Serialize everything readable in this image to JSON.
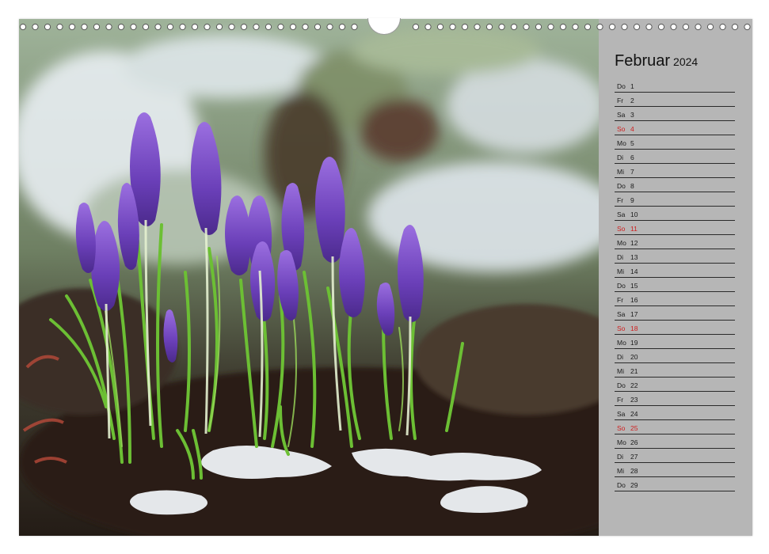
{
  "calendar": {
    "month": "Februar",
    "year": "2024",
    "days": [
      {
        "dow": "Do",
        "day": "1",
        "sunday": false
      },
      {
        "dow": "Fr",
        "day": "2",
        "sunday": false
      },
      {
        "dow": "Sa",
        "day": "3",
        "sunday": false
      },
      {
        "dow": "So",
        "day": "4",
        "sunday": true
      },
      {
        "dow": "Mo",
        "day": "5",
        "sunday": false
      },
      {
        "dow": "Di",
        "day": "6",
        "sunday": false
      },
      {
        "dow": "Mi",
        "day": "7",
        "sunday": false
      },
      {
        "dow": "Do",
        "day": "8",
        "sunday": false
      },
      {
        "dow": "Fr",
        "day": "9",
        "sunday": false
      },
      {
        "dow": "Sa",
        "day": "10",
        "sunday": false
      },
      {
        "dow": "So",
        "day": "11",
        "sunday": true
      },
      {
        "dow": "Mo",
        "day": "12",
        "sunday": false
      },
      {
        "dow": "Di",
        "day": "13",
        "sunday": false
      },
      {
        "dow": "Mi",
        "day": "14",
        "sunday": false
      },
      {
        "dow": "Do",
        "day": "15",
        "sunday": false
      },
      {
        "dow": "Fr",
        "day": "16",
        "sunday": false
      },
      {
        "dow": "Sa",
        "day": "17",
        "sunday": false
      },
      {
        "dow": "So",
        "day": "18",
        "sunday": true
      },
      {
        "dow": "Mo",
        "day": "19",
        "sunday": false
      },
      {
        "dow": "Di",
        "day": "20",
        "sunday": false
      },
      {
        "dow": "Mi",
        "day": "21",
        "sunday": false
      },
      {
        "dow": "Do",
        "day": "22",
        "sunday": false
      },
      {
        "dow": "Fr",
        "day": "23",
        "sunday": false
      },
      {
        "dow": "Sa",
        "day": "24",
        "sunday": false
      },
      {
        "dow": "So",
        "day": "25",
        "sunday": true
      },
      {
        "dow": "Mo",
        "day": "26",
        "sunday": false
      },
      {
        "dow": "Di",
        "day": "27",
        "sunday": false
      },
      {
        "dow": "Mi",
        "day": "28",
        "sunday": false
      },
      {
        "dow": "Do",
        "day": "29",
        "sunday": false
      }
    ]
  },
  "colors": {
    "sidebar": "#b6b6b6",
    "sunday": "#d01f1f",
    "text": "#111111",
    "crocus": "#7b4fc4",
    "leaves": "#5fae2e"
  }
}
